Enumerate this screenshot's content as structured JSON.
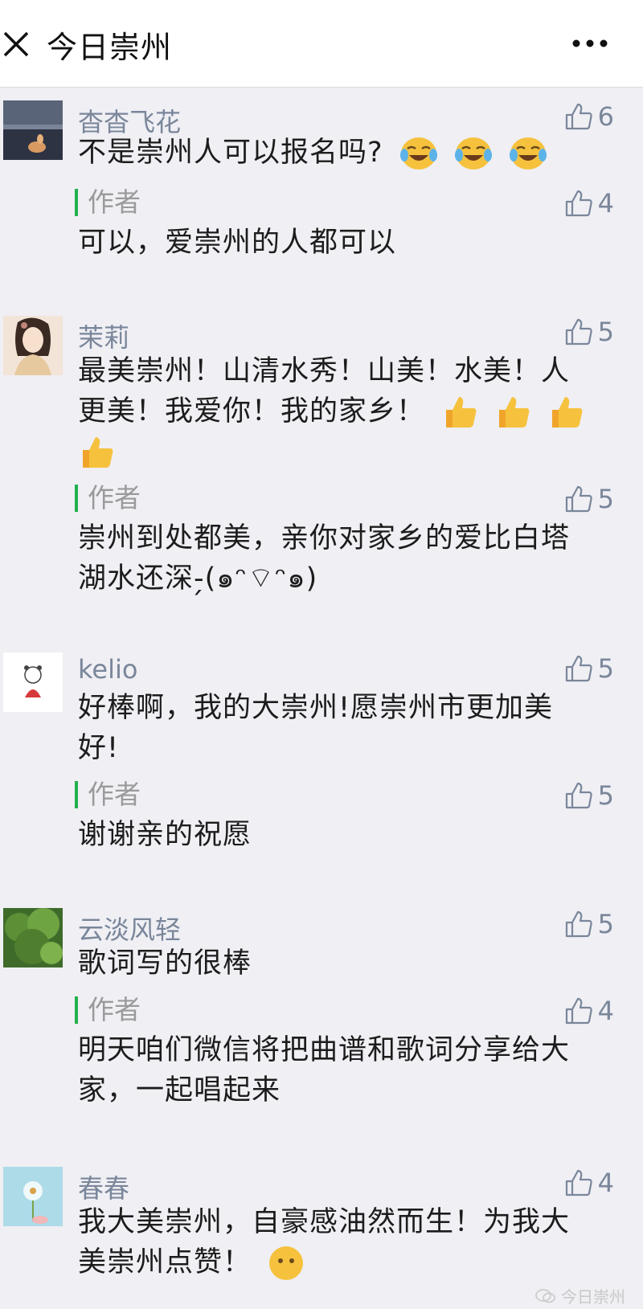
{
  "header": {
    "title": "今日崇州",
    "close_icon": "close-icon",
    "more_icon": "more-icon"
  },
  "comments": [
    {
      "nickname": "杳杳飞花",
      "likes": "6",
      "text": "不是崇州人可以报名吗?",
      "emoji": "tears-of-joy-emoji ×3",
      "reply": {
        "label": "作者",
        "likes": "4",
        "text": "可以，爱崇州的人都可以"
      }
    },
    {
      "nickname": "茉莉",
      "likes": "5",
      "text_line1": "最美崇州！山清水秀！山美！水美！人",
      "text_line2": "更美！我爱你！我的家乡！",
      "emoji": "thumbs-up-emoji ×4",
      "reply": {
        "label": "作者",
        "likes": "5",
        "text_line1": "崇州到处都美，亲你对家乡的爱比白塔",
        "text_line2": "湖水还深-̗(๑ᵔ⌔ᵔ๑)"
      }
    },
    {
      "nickname": "kelio",
      "likes": "5",
      "text_line1": "好棒啊，我的大崇州!愿崇州市更加美",
      "text_line2": "好!",
      "reply": {
        "label": "作者",
        "likes": "5",
        "text": "谢谢亲的祝愿"
      }
    },
    {
      "nickname": "云淡风轻",
      "likes": "5",
      "text": "歌词写的很棒",
      "reply": {
        "label": "作者",
        "likes": "4",
        "text_line1": "明天咱们微信将把曲谱和歌词分享给大",
        "text_line2": "家，一起唱起来"
      }
    },
    {
      "nickname": "春春",
      "likes": "4",
      "text_line1": "我大美崇州，自豪感油然而生！为我大",
      "text_line2": "美崇州点赞！"
    }
  ],
  "watermark": "今日崇州",
  "colors": {
    "nickname": "#7a869a",
    "author_bar": "#22b14c",
    "background": "#efeff4"
  }
}
